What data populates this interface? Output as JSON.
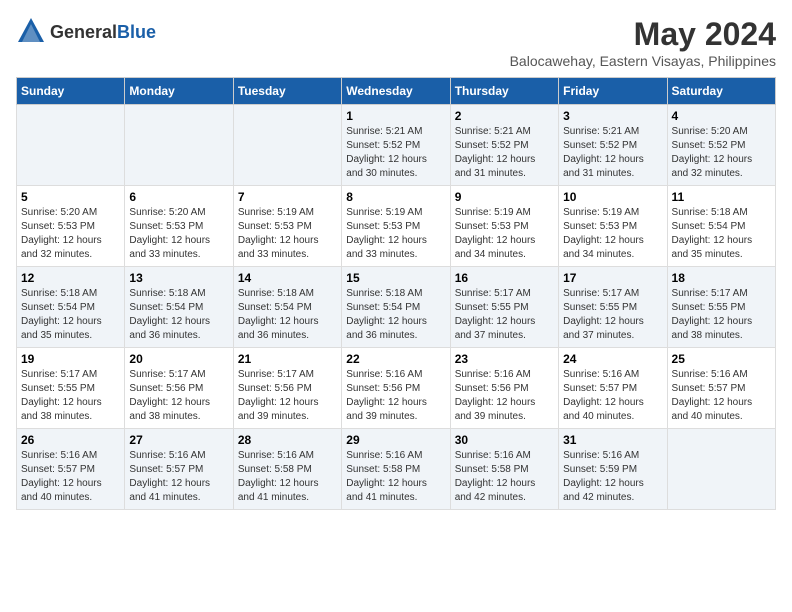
{
  "header": {
    "logo_general": "General",
    "logo_blue": "Blue",
    "title": "May 2024",
    "subtitle": "Balocawehay, Eastern Visayas, Philippines"
  },
  "days_of_week": [
    "Sunday",
    "Monday",
    "Tuesday",
    "Wednesday",
    "Thursday",
    "Friday",
    "Saturday"
  ],
  "weeks": [
    [
      {
        "day": "",
        "sunrise": "",
        "sunset": "",
        "daylight": ""
      },
      {
        "day": "",
        "sunrise": "",
        "sunset": "",
        "daylight": ""
      },
      {
        "day": "",
        "sunrise": "",
        "sunset": "",
        "daylight": ""
      },
      {
        "day": "1",
        "sunrise": "Sunrise: 5:21 AM",
        "sunset": "Sunset: 5:52 PM",
        "daylight": "Daylight: 12 hours and 30 minutes."
      },
      {
        "day": "2",
        "sunrise": "Sunrise: 5:21 AM",
        "sunset": "Sunset: 5:52 PM",
        "daylight": "Daylight: 12 hours and 31 minutes."
      },
      {
        "day": "3",
        "sunrise": "Sunrise: 5:21 AM",
        "sunset": "Sunset: 5:52 PM",
        "daylight": "Daylight: 12 hours and 31 minutes."
      },
      {
        "day": "4",
        "sunrise": "Sunrise: 5:20 AM",
        "sunset": "Sunset: 5:52 PM",
        "daylight": "Daylight: 12 hours and 32 minutes."
      }
    ],
    [
      {
        "day": "5",
        "sunrise": "Sunrise: 5:20 AM",
        "sunset": "Sunset: 5:53 PM",
        "daylight": "Daylight: 12 hours and 32 minutes."
      },
      {
        "day": "6",
        "sunrise": "Sunrise: 5:20 AM",
        "sunset": "Sunset: 5:53 PM",
        "daylight": "Daylight: 12 hours and 33 minutes."
      },
      {
        "day": "7",
        "sunrise": "Sunrise: 5:19 AM",
        "sunset": "Sunset: 5:53 PM",
        "daylight": "Daylight: 12 hours and 33 minutes."
      },
      {
        "day": "8",
        "sunrise": "Sunrise: 5:19 AM",
        "sunset": "Sunset: 5:53 PM",
        "daylight": "Daylight: 12 hours and 33 minutes."
      },
      {
        "day": "9",
        "sunrise": "Sunrise: 5:19 AM",
        "sunset": "Sunset: 5:53 PM",
        "daylight": "Daylight: 12 hours and 34 minutes."
      },
      {
        "day": "10",
        "sunrise": "Sunrise: 5:19 AM",
        "sunset": "Sunset: 5:53 PM",
        "daylight": "Daylight: 12 hours and 34 minutes."
      },
      {
        "day": "11",
        "sunrise": "Sunrise: 5:18 AM",
        "sunset": "Sunset: 5:54 PM",
        "daylight": "Daylight: 12 hours and 35 minutes."
      }
    ],
    [
      {
        "day": "12",
        "sunrise": "Sunrise: 5:18 AM",
        "sunset": "Sunset: 5:54 PM",
        "daylight": "Daylight: 12 hours and 35 minutes."
      },
      {
        "day": "13",
        "sunrise": "Sunrise: 5:18 AM",
        "sunset": "Sunset: 5:54 PM",
        "daylight": "Daylight: 12 hours and 36 minutes."
      },
      {
        "day": "14",
        "sunrise": "Sunrise: 5:18 AM",
        "sunset": "Sunset: 5:54 PM",
        "daylight": "Daylight: 12 hours and 36 minutes."
      },
      {
        "day": "15",
        "sunrise": "Sunrise: 5:18 AM",
        "sunset": "Sunset: 5:54 PM",
        "daylight": "Daylight: 12 hours and 36 minutes."
      },
      {
        "day": "16",
        "sunrise": "Sunrise: 5:17 AM",
        "sunset": "Sunset: 5:55 PM",
        "daylight": "Daylight: 12 hours and 37 minutes."
      },
      {
        "day": "17",
        "sunrise": "Sunrise: 5:17 AM",
        "sunset": "Sunset: 5:55 PM",
        "daylight": "Daylight: 12 hours and 37 minutes."
      },
      {
        "day": "18",
        "sunrise": "Sunrise: 5:17 AM",
        "sunset": "Sunset: 5:55 PM",
        "daylight": "Daylight: 12 hours and 38 minutes."
      }
    ],
    [
      {
        "day": "19",
        "sunrise": "Sunrise: 5:17 AM",
        "sunset": "Sunset: 5:55 PM",
        "daylight": "Daylight: 12 hours and 38 minutes."
      },
      {
        "day": "20",
        "sunrise": "Sunrise: 5:17 AM",
        "sunset": "Sunset: 5:56 PM",
        "daylight": "Daylight: 12 hours and 38 minutes."
      },
      {
        "day": "21",
        "sunrise": "Sunrise: 5:17 AM",
        "sunset": "Sunset: 5:56 PM",
        "daylight": "Daylight: 12 hours and 39 minutes."
      },
      {
        "day": "22",
        "sunrise": "Sunrise: 5:16 AM",
        "sunset": "Sunset: 5:56 PM",
        "daylight": "Daylight: 12 hours and 39 minutes."
      },
      {
        "day": "23",
        "sunrise": "Sunrise: 5:16 AM",
        "sunset": "Sunset: 5:56 PM",
        "daylight": "Daylight: 12 hours and 39 minutes."
      },
      {
        "day": "24",
        "sunrise": "Sunrise: 5:16 AM",
        "sunset": "Sunset: 5:57 PM",
        "daylight": "Daylight: 12 hours and 40 minutes."
      },
      {
        "day": "25",
        "sunrise": "Sunrise: 5:16 AM",
        "sunset": "Sunset: 5:57 PM",
        "daylight": "Daylight: 12 hours and 40 minutes."
      }
    ],
    [
      {
        "day": "26",
        "sunrise": "Sunrise: 5:16 AM",
        "sunset": "Sunset: 5:57 PM",
        "daylight": "Daylight: 12 hours and 40 minutes."
      },
      {
        "day": "27",
        "sunrise": "Sunrise: 5:16 AM",
        "sunset": "Sunset: 5:57 PM",
        "daylight": "Daylight: 12 hours and 41 minutes."
      },
      {
        "day": "28",
        "sunrise": "Sunrise: 5:16 AM",
        "sunset": "Sunset: 5:58 PM",
        "daylight": "Daylight: 12 hours and 41 minutes."
      },
      {
        "day": "29",
        "sunrise": "Sunrise: 5:16 AM",
        "sunset": "Sunset: 5:58 PM",
        "daylight": "Daylight: 12 hours and 41 minutes."
      },
      {
        "day": "30",
        "sunrise": "Sunrise: 5:16 AM",
        "sunset": "Sunset: 5:58 PM",
        "daylight": "Daylight: 12 hours and 42 minutes."
      },
      {
        "day": "31",
        "sunrise": "Sunrise: 5:16 AM",
        "sunset": "Sunset: 5:59 PM",
        "daylight": "Daylight: 12 hours and 42 minutes."
      },
      {
        "day": "",
        "sunrise": "",
        "sunset": "",
        "daylight": ""
      }
    ]
  ]
}
